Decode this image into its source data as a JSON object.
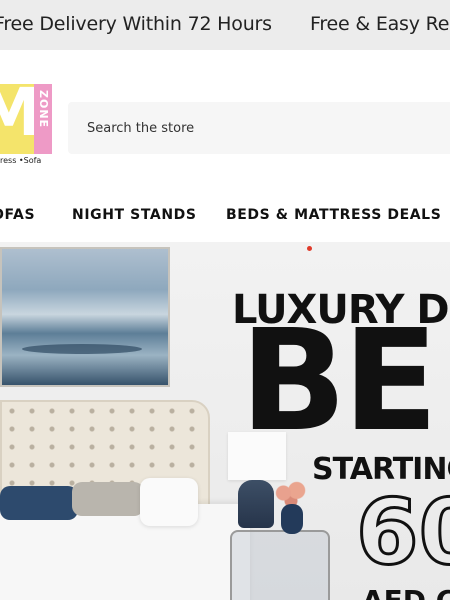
{
  "announcement": {
    "messages": [
      "Free Delivery Within 72 Hours",
      "Free & Easy Re"
    ],
    "background": "#ececec"
  },
  "logo": {
    "letter": "M",
    "word": "ZONE",
    "tagline": "ress •Sofa",
    "colors": {
      "yellow": "#f4e46b",
      "pink": "#ee9ac6"
    }
  },
  "search": {
    "placeholder": "Search the store"
  },
  "nav": {
    "items": [
      "OFAS",
      "NIGHT STANDS",
      "BEDS & MATTRESS DEALS"
    ]
  },
  "hero": {
    "line1": "LUXURY DIS",
    "line2": "BE",
    "line3": "STARTING",
    "line4": "60",
    "line5": "AED C",
    "accent_dot": "#e03a2a"
  }
}
